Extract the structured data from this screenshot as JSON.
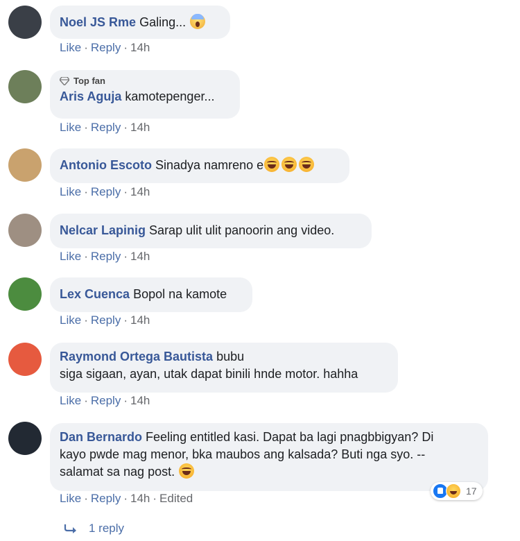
{
  "comments": [
    {
      "author": "Noel JS Rme",
      "text": "Galing...",
      "emoji": "shock",
      "time": "14h",
      "avatar_color": "#3a3f47",
      "top_fan": null
    },
    {
      "author": "Aris Aguja",
      "text": "kamotepenger...",
      "time": "14h",
      "avatar_color": "#6d7f5a",
      "top_fan": "Top fan"
    },
    {
      "author": "Antonio Escoto",
      "text": "Sinadya namreno e",
      "emoji": "laugh",
      "time": "14h",
      "avatar_color": "#c9a26e",
      "top_fan": null
    },
    {
      "author": "Nelcar Lapinig",
      "text": "Sarap ulit ulit panoorin ang video.",
      "time": "14h",
      "avatar_color": "#9e8f82",
      "top_fan": null
    },
    {
      "author": "Lex Cuenca",
      "text": "Bopol na kamote",
      "time": "14h",
      "avatar_color": "#4c8c3f",
      "top_fan": null
    },
    {
      "author": "Raymond Ortega Bautista",
      "text": "bubu",
      "text_line2": "siga sigaan, ayan, utak dapat binili hnde motor. hahha",
      "time": "14h",
      "avatar_color": "#e65a3f",
      "top_fan": null
    },
    {
      "author": "Dan Bernardo",
      "text": "Feeling entitled kasi. Dapat ba lagi pnagbbigyan? Di",
      "text_line2": "kayo pwde mag menor, bka maubos ang kalsada? Buti nga syo. --",
      "text_line3": "salamat sa nag post.",
      "time": "14h",
      "edited": "Edited",
      "avatar_color": "#222933",
      "top_fan": null
    }
  ],
  "actions": {
    "like": "Like",
    "reply": "Reply",
    "dot": "·"
  },
  "reactions": {
    "count": "17"
  },
  "replies": {
    "label": "1 reply"
  },
  "colors": {
    "author": "#385898",
    "bubble": "#f0f2f5",
    "action": "#4b6ea8"
  }
}
